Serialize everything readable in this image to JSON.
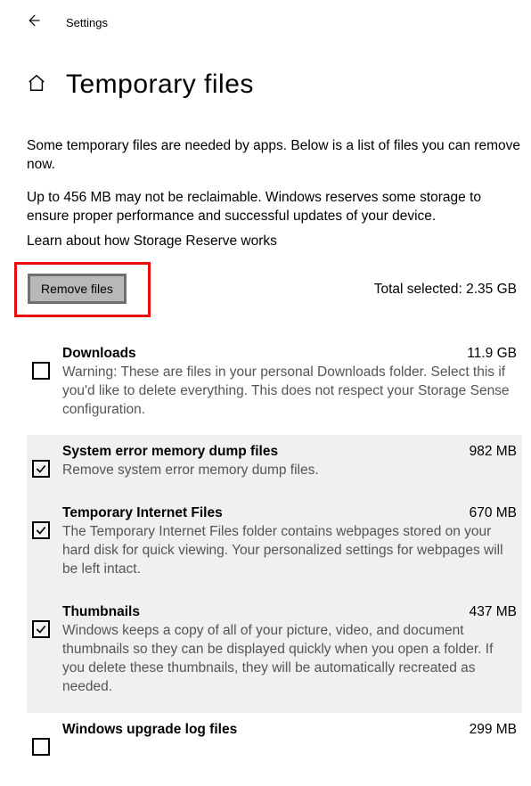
{
  "header": {
    "back_icon": "back-arrow",
    "label": "Settings"
  },
  "title": {
    "home_icon": "home-icon",
    "text": "Temporary files"
  },
  "intro_text": "Some temporary files are needed by apps. Below is a list of files you can remove now.",
  "reserve_text": "Up to 456 MB may not be reclaimable. Windows reserves some storage to ensure proper performance and successful updates of your device.",
  "learn_link": "Learn about how Storage Reserve works",
  "action": {
    "remove_label": "Remove files",
    "total_label": "Total selected: 2.35 GB"
  },
  "items": [
    {
      "checked": false,
      "selected": false,
      "title": "Downloads",
      "size": "11.9 GB",
      "desc": "Warning: These are files in your personal Downloads folder. Select this if you'd like to delete everything. This does not respect your Storage Sense configuration."
    },
    {
      "checked": true,
      "selected": true,
      "title": "System error memory dump files",
      "size": "982 MB",
      "desc": "Remove system error memory dump files."
    },
    {
      "checked": true,
      "selected": true,
      "title": "Temporary Internet Files",
      "size": "670 MB",
      "desc": "The Temporary Internet Files folder contains webpages stored on your hard disk for quick viewing. Your personalized settings for webpages will be left intact."
    },
    {
      "checked": true,
      "selected": true,
      "title": "Thumbnails",
      "size": "437 MB",
      "desc": "Windows keeps a copy of all of your picture, video, and document thumbnails so they can be displayed quickly when you open a folder. If you delete these thumbnails, they will be automatically recreated as needed."
    },
    {
      "checked": false,
      "selected": false,
      "title": "Windows upgrade log files",
      "size": "299 MB",
      "desc": ""
    }
  ]
}
